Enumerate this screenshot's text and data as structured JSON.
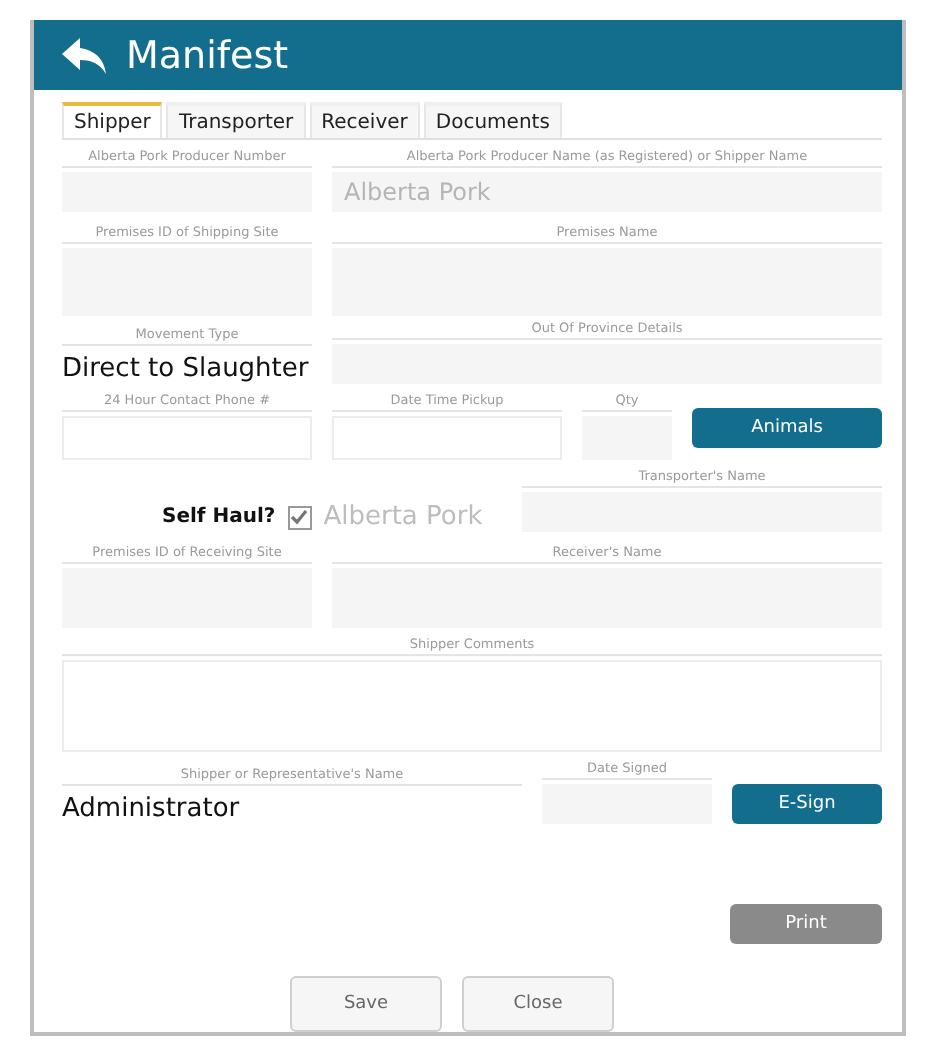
{
  "header": {
    "title": "Manifest"
  },
  "tabs": [
    {
      "label": "Shipper",
      "selected": true
    },
    {
      "label": "Transporter",
      "selected": false
    },
    {
      "label": "Receiver",
      "selected": false
    },
    {
      "label": "Documents",
      "selected": false
    }
  ],
  "producer_number": {
    "label": "Alberta Pork Producer Number"
  },
  "producer_name": {
    "label": "Alberta Pork Producer Name (as Registered) or Shipper Name",
    "value": "Alberta Pork",
    "disabled": true
  },
  "shipping_premises_id": {
    "label": "Premises ID of Shipping Site"
  },
  "premises_name": {
    "label": "Premises Name"
  },
  "movement_type": {
    "label": "Movement Type",
    "value": "Direct to Slaughter"
  },
  "out_of_province": {
    "label": "Out Of Province Details"
  },
  "contact_phone": {
    "label": "24 Hour Contact Phone #"
  },
  "pickup_time": {
    "label": "Date Time Pickup"
  },
  "quantity": {
    "label": "Qty"
  },
  "animals_button": {
    "label": "Animals"
  },
  "transporter_name": {
    "label": "Transporter's Name"
  },
  "self_haul": {
    "label": "Self Haul?",
    "checked": true,
    "value": "Alberta Pork"
  },
  "receiving_premises_id": {
    "label": "Premises ID of Receiving Site"
  },
  "receiver_name": {
    "label": "Receiver's Name"
  },
  "comments": {
    "label": "Shipper Comments"
  },
  "representative": {
    "label": "Shipper or Representative's Name",
    "value": "Administrator"
  },
  "date_signed": {
    "label": "Date Signed"
  },
  "esign_button": {
    "label": "E-Sign"
  },
  "print_button": {
    "label": "Print",
    "disabled": true
  },
  "footer_buttons": [
    "Save",
    "Close"
  ]
}
